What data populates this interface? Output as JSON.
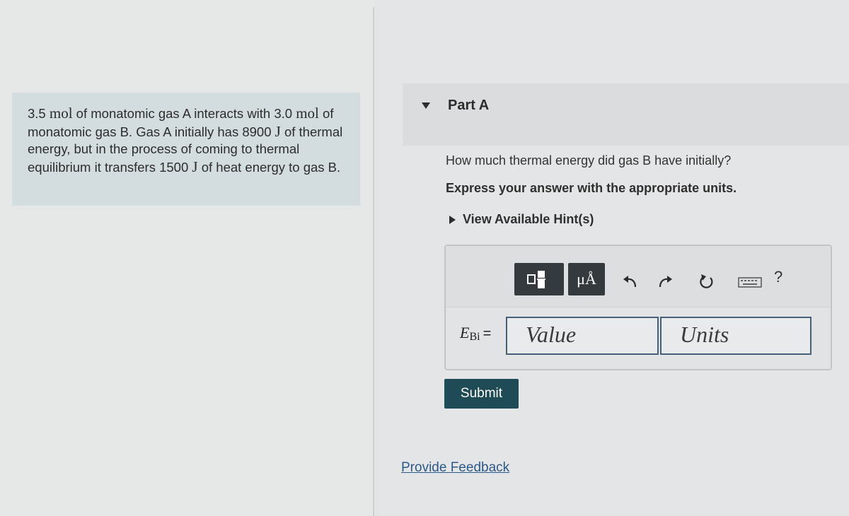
{
  "problem": {
    "segments": [
      {
        "text": "3.5 "
      },
      {
        "text": "mol",
        "unit": true
      },
      {
        "text": " of monatomic gas A interacts with "
      },
      {
        "text": "3.0 "
      },
      {
        "text": "mol",
        "unit": true
      },
      {
        "text": " of monatomic gas B. Gas A initially has "
      },
      {
        "text": "8900 "
      },
      {
        "text": "J",
        "unit": true
      },
      {
        "text": " of thermal energy, but in the process of coming to thermal equilibrium it transfers 1500 "
      },
      {
        "text": "J",
        "unit": true
      },
      {
        "text": " of heat energy to gas B."
      }
    ]
  },
  "part": {
    "title": "Part A",
    "question": "How much thermal energy did gas B have initially?",
    "instruction": "Express your answer with the appropriate units.",
    "hint_label": "View Available Hint(s)"
  },
  "toolbar": {
    "buttons": [
      {
        "name": "templates",
        "icon": "templates-icon"
      },
      {
        "name": "units",
        "label": "μÅ",
        "icon": "units-icon"
      },
      {
        "name": "undo",
        "icon": "undo-icon"
      },
      {
        "name": "redo",
        "icon": "redo-icon"
      },
      {
        "name": "reset",
        "icon": "reset-icon"
      },
      {
        "name": "keyboard",
        "icon": "keyboard-icon"
      },
      {
        "name": "help",
        "label": "?",
        "icon": "help-icon"
      }
    ]
  },
  "answer": {
    "variable": "E",
    "subscript": "Bi",
    "equals": "=",
    "value_placeholder": "Value",
    "units_placeholder": "Units"
  },
  "submit_label": "Submit",
  "feedback_label": "Provide Feedback",
  "colors": {
    "submit_bg": "#1e4b55",
    "link": "#2b5a8a",
    "toolbar_button": "#343a3e"
  }
}
